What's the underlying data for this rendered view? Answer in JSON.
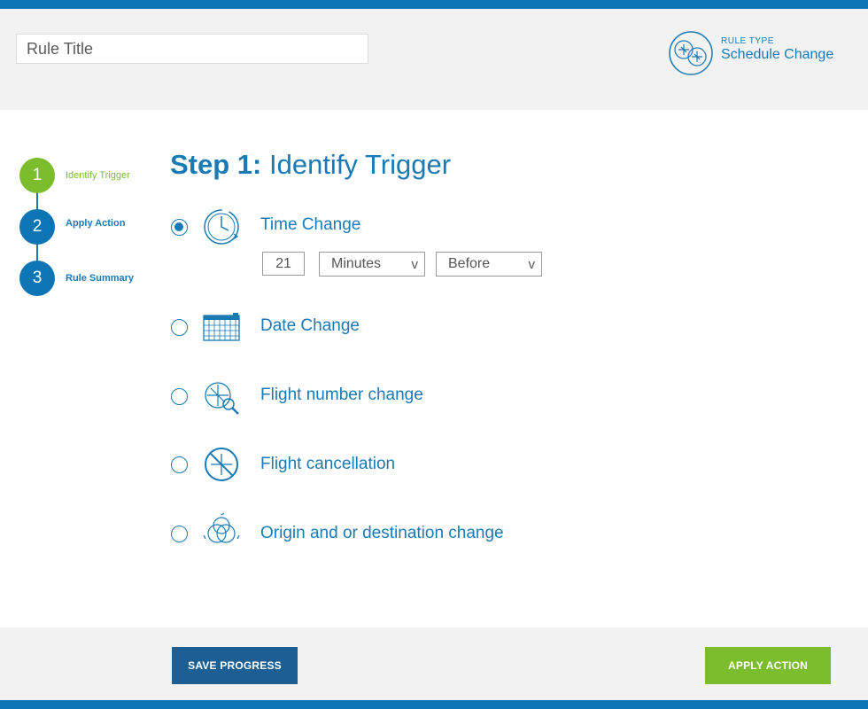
{
  "header": {
    "title_placeholder": "Rule Title",
    "rule_type_label": "RULE TYPE",
    "rule_type_value": "Schedule Change",
    "icon": "schedule-change-icon"
  },
  "stepper": [
    {
      "number": "1",
      "label": "Identify Trigger",
      "state": "active",
      "color": "#7cbd2d"
    },
    {
      "number": "2",
      "label": "Apply Action",
      "state": "pending",
      "color": "#1a7ab4"
    },
    {
      "number": "3",
      "label": "Rule Summary",
      "state": "pending",
      "color": "#1a7ab4"
    }
  ],
  "main": {
    "heading_prefix": "Step 1:",
    "heading_title": "Identify Trigger",
    "options": [
      {
        "label": "Time Change",
        "selected": true,
        "icon": "clock-icon"
      },
      {
        "label": "Date Change",
        "selected": false,
        "icon": "calendar-icon"
      },
      {
        "label": "Flight number change",
        "selected": false,
        "icon": "flight-search-icon"
      },
      {
        "label": "Flight cancellation",
        "selected": false,
        "icon": "flight-cancel-icon"
      },
      {
        "label": "Origin and or destination change",
        "selected": false,
        "icon": "route-change-icon"
      }
    ],
    "time_change": {
      "amount": "21",
      "unit": "Minutes",
      "relation": "Before"
    }
  },
  "footer": {
    "save_label": "SAVE PROGRESS",
    "apply_label": "APPLY ACTION"
  },
  "colors": {
    "primary": "#1a7ab4",
    "accent_green": "#7cbd2d",
    "save_button": "#1d5f93",
    "header_bg": "#f2f2f2"
  }
}
